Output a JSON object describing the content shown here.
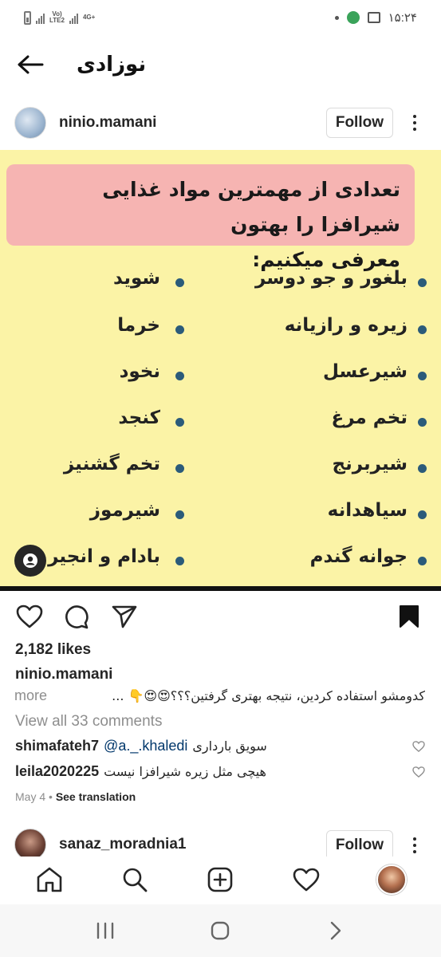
{
  "status_bar": {
    "network_label_top": "Vo)",
    "network_label_bottom": "LTE2",
    "network_type": "4G+",
    "time": "۱۵:۲۴"
  },
  "header": {
    "title": "نوزادی",
    "back_icon": "arrow-left-icon"
  },
  "post": {
    "username": "ninio.mamani",
    "follow_label": "Follow",
    "image": {
      "banner_line1": "تعدادی از مهمترین مواد غذایی شیرافزا را بهتون",
      "banner_line2": "معرفی میکنیم:",
      "right_column": [
        "بلغور و جو دوسر",
        "زیره و رازیانه",
        "شیرعسل",
        "تخم مرغ",
        "شیربرنج",
        "سیاهدانه",
        "جوانه گندم"
      ],
      "left_column": [
        "شوید",
        "خرما",
        "نخود",
        "کنجد",
        "تخم گشنیز",
        "شیرموز",
        "بادام و انجیر"
      ],
      "bg_color": "#fbf3a6",
      "banner_color": "#f6b4b2",
      "bullet_color": "#2b5b7a"
    },
    "likes": "2,182 likes",
    "caption_user": "ninio.mamani",
    "caption_text": "کدومشو استفاده کردین، نتیجه بهتری گرفتین؟؟؟😍😍👇 ...",
    "caption_more": "more",
    "view_comments": "View all 33 comments",
    "comments": [
      {
        "user": "shimafateh7",
        "mention": "@a._.khaledi",
        "text": "سویق بارداری"
      },
      {
        "user": "leila2020225",
        "mention": "",
        "text": "هیچی مثل زیره شیرافزا نیست"
      }
    ],
    "date": "May 4",
    "see_translation": "See translation"
  },
  "next_post": {
    "username": "sanaz_moradnia1",
    "follow_label": "Follow"
  },
  "bottom_nav": [
    "home-icon",
    "search-icon",
    "add-post-icon",
    "activity-heart-icon",
    "profile-avatar"
  ],
  "system_nav": [
    "recent-apps-icon",
    "home-circle-icon",
    "back-chevron-icon"
  ]
}
